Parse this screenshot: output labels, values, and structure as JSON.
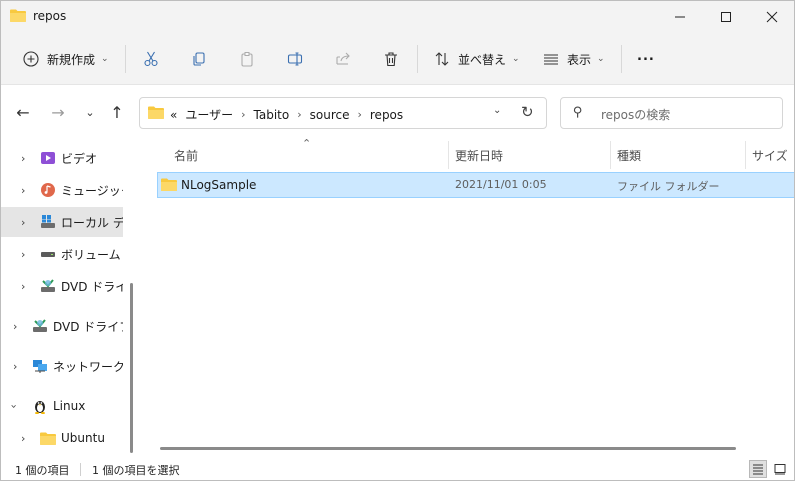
{
  "window": {
    "title": "repos"
  },
  "toolbar": {
    "new_label": "新規作成",
    "sort_label": "並べ替え",
    "view_label": "表示",
    "more_label": "..."
  },
  "address": {
    "overflow": "«",
    "crumbs": [
      "ユーザー",
      "Tabito",
      "source",
      "repos"
    ]
  },
  "search": {
    "placeholder": "reposの検索"
  },
  "sidebar": {
    "items": [
      {
        "label": "ビデオ",
        "icon": "video-icon"
      },
      {
        "label": "ミュージック",
        "icon": "music-icon"
      },
      {
        "label": "ローカル ディス",
        "icon": "drive-icon"
      },
      {
        "label": "ボリューム (D:",
        "icon": "drive-icon"
      },
      {
        "label": "DVD ドライブ",
        "icon": "dvd-icon"
      },
      {
        "label": "DVD ドライブ (",
        "icon": "dvd-icon"
      },
      {
        "label": "ネットワーク",
        "icon": "network-icon"
      },
      {
        "label": "Linux",
        "icon": "penguin-icon"
      },
      {
        "label": "Ubuntu",
        "icon": "folder-icon"
      }
    ]
  },
  "columns": {
    "name": "名前",
    "date": "更新日時",
    "type": "種類",
    "size": "サイズ"
  },
  "files": [
    {
      "name": "NLogSample",
      "date": "2021/11/01 0:05",
      "type": "ファイル フォルダー"
    }
  ],
  "status": {
    "count": "1 個の項目",
    "selected": "1 個の項目を選択"
  },
  "colors": {
    "folder": "#f8c93f",
    "selection": "#cce8ff",
    "selection_border": "#99d1ff",
    "chrome": "#f3f3f3"
  }
}
